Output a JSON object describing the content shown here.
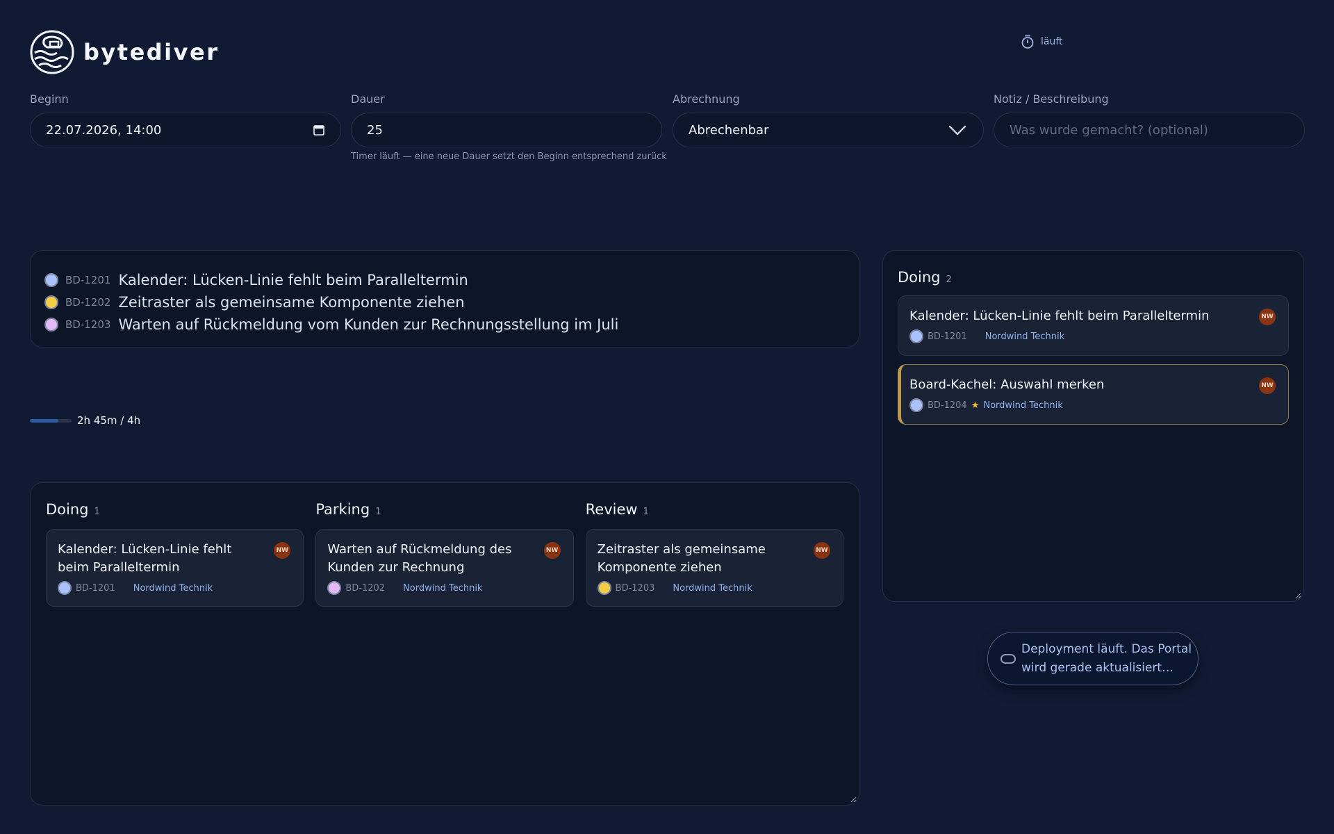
{
  "app": {
    "brand": "bytediver",
    "logo_icon": "diver-wave-logo"
  },
  "timer": {
    "status": "läuft",
    "icon": "stopwatch-icon"
  },
  "form": {
    "start": {
      "label": "Beginn",
      "value": "22.07.2026, 14:00",
      "icon": "calendar-icon"
    },
    "duration": {
      "label": "Dauer",
      "value": "25",
      "hint": "Timer läuft — eine neue Dauer setzt den Beginn entsprechend zurück"
    },
    "billing": {
      "label": "Abrechnung",
      "value": "Abrechenbar",
      "icon": "chevron-down-icon"
    },
    "note": {
      "label": "Notiz / Beschreibung",
      "placeholder": "Was wurde gemacht? (optional)"
    }
  },
  "ticket_list": [
    {
      "id": "BD-1201",
      "title": "Kalender: Lücken-Linie fehlt beim Paralleltermin",
      "color": "#a9c2ff"
    },
    {
      "id": "BD-1202",
      "title": "Zeitraster als gemeinsame Komponente ziehen",
      "color": "#f5cd44"
    },
    {
      "id": "BD-1203",
      "title": "Warten auf Rückmeldung vom Kunden zur Rechnungsstellung im Juli",
      "color": "#e3b9f7"
    }
  ],
  "progress": {
    "text": "2h 45m / 4h",
    "fraction": 0.6875,
    "color": "#2e5aa3"
  },
  "board": {
    "columns": [
      {
        "title": "Doing",
        "count": "1",
        "cards": [
          {
            "title": "Kalender: Lücken-Linie fehlt beim Paralleltermin",
            "id": "BD-1201",
            "customer": "Nordwind Technik",
            "badge": "NW",
            "color": "#a9c2ff"
          }
        ]
      },
      {
        "title": "Parking",
        "count": "1",
        "cards": [
          {
            "title": "Warten auf Rückmeldung des Kunden zur Rechnung",
            "id": "BD-1202",
            "customer": "Nordwind Technik",
            "badge": "NW",
            "color": "#e3b9f7"
          }
        ]
      },
      {
        "title": "Review",
        "count": "1",
        "cards": [
          {
            "title": "Zeitraster als gemeinsame Komponente ziehen",
            "id": "BD-1203",
            "customer": "Nordwind Technik",
            "badge": "NW",
            "color": "#f5cd44"
          }
        ]
      }
    ]
  },
  "doing_panel": {
    "title": "Doing",
    "count": "2",
    "cards": [
      {
        "title": "Kalender: Lücken-Linie fehlt beim Paralleltermin",
        "id": "BD-1201",
        "customer": "Nordwind Technik",
        "badge": "NW",
        "color": "#a9c2ff",
        "starred": false,
        "selected": false
      },
      {
        "title": "Board-Kachel: Auswahl merken",
        "id": "BD-1204",
        "customer": "Nordwind Technik",
        "badge": "NW",
        "color": "#a9c2ff",
        "starred": true,
        "selected": true
      }
    ]
  },
  "toast": {
    "text": "Deployment läuft. Das Portal wird gerade aktualisiert…",
    "icon": "spinner-icon"
  }
}
